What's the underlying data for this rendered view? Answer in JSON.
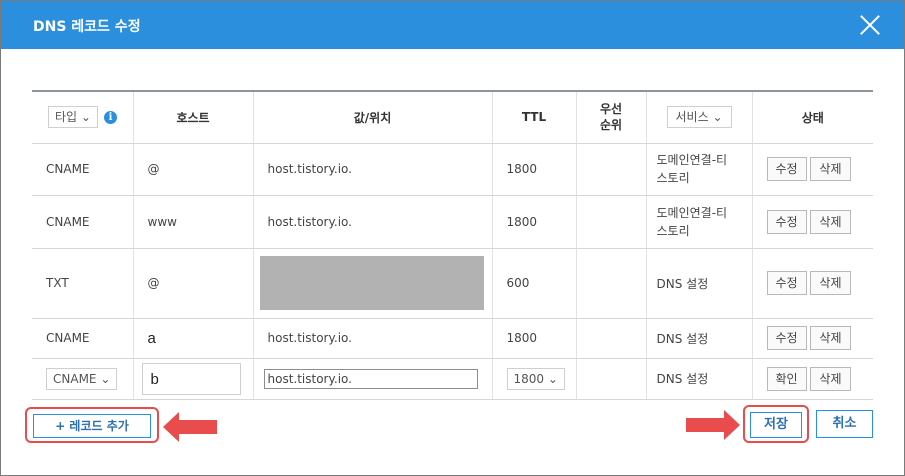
{
  "dialog": {
    "title": "DNS 레코드 수정"
  },
  "header": {
    "type_select": "타입",
    "info_icon": "i",
    "host": "호스트",
    "value": "값/위치",
    "ttl": "TTL",
    "priority_line1": "우선",
    "priority_line2": "순위",
    "service_select": "서비스",
    "status": "상태"
  },
  "rows": [
    {
      "type": "CNAME",
      "host": "@",
      "value": "host.tistory.io.",
      "ttl": "1800",
      "service_line1": "도메인연결-티",
      "service_line2": "스토리",
      "edit": "수정",
      "delete": "삭제"
    },
    {
      "type": "CNAME",
      "host": "www",
      "value": "host.tistory.io.",
      "ttl": "1800",
      "service_line1": "도메인연결-티",
      "service_line2": "스토리",
      "edit": "수정",
      "delete": "삭제"
    },
    {
      "type": "TXT",
      "host": "@",
      "value": "",
      "ttl": "600",
      "service": "DNS 설정",
      "edit": "수정",
      "delete": "삭제"
    },
    {
      "type": "CNAME",
      "host": "a",
      "value": "host.tistory.io.",
      "ttl": "1800",
      "service": "DNS 설정",
      "edit": "수정",
      "delete": "삭제"
    }
  ],
  "edit_row": {
    "type_select": "CNAME",
    "host": "b",
    "value": "host.tistory.io.",
    "ttl_select": "1800",
    "service": "DNS 설정",
    "confirm": "확인",
    "delete": "삭제"
  },
  "footer": {
    "add_record": "+ 레코드 추가",
    "save": "저장",
    "cancel": "취소"
  },
  "colors": {
    "accent": "#2b8fde",
    "highlight": "#e84c4c"
  }
}
